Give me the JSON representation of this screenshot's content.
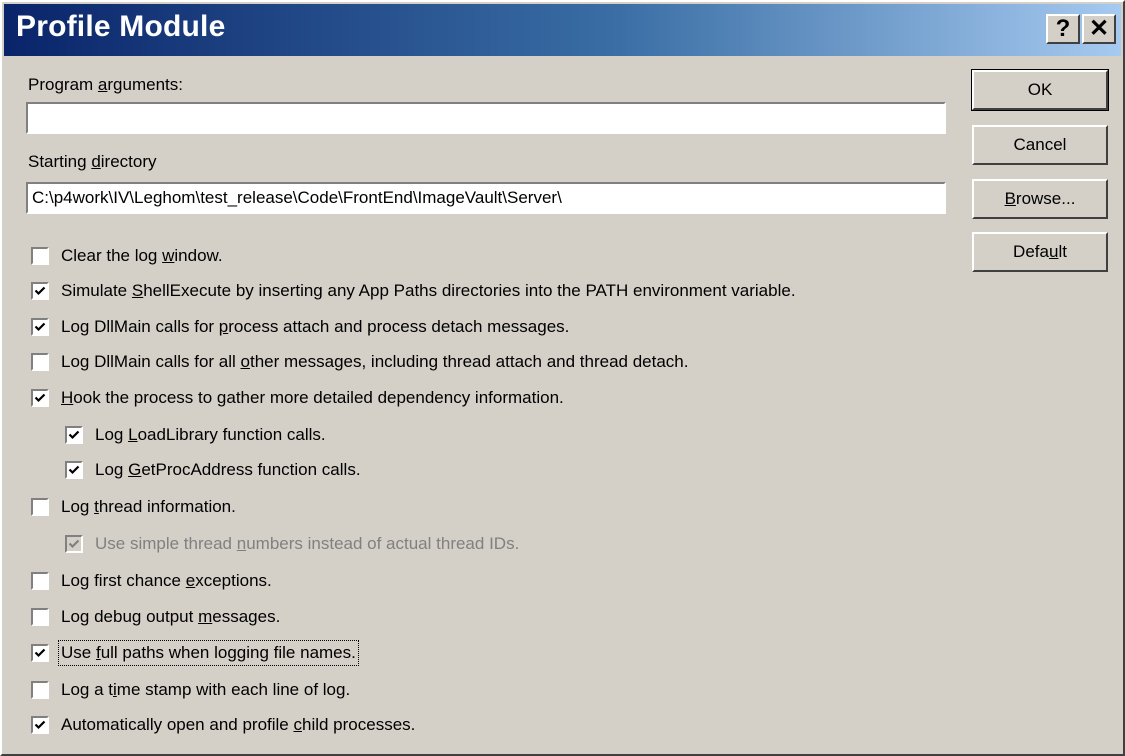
{
  "window": {
    "title": "Profile Module",
    "help_label": "?",
    "close_label": "✕"
  },
  "fields": {
    "program_arguments": {
      "label_pre": "Program ",
      "label_key": "a",
      "label_post": "rguments:",
      "value": ""
    },
    "starting_directory": {
      "label_pre": "Starting ",
      "label_key": "d",
      "label_post": "irectory",
      "value": "C:\\p4work\\IV\\Leghom\\test_release\\Code\\FrontEnd\\ImageVault\\Server\\"
    }
  },
  "buttons": {
    "ok": {
      "label": "OK"
    },
    "cancel": {
      "label": "Cancel"
    },
    "browse": {
      "pre": "",
      "key": "B",
      "post": "rowse..."
    },
    "default": {
      "pre": "Defa",
      "key": "u",
      "post": "lt"
    }
  },
  "options": [
    {
      "pre": "Clear the log ",
      "key": "w",
      "post": "indow.",
      "checked": false,
      "disabled": false
    },
    {
      "pre": "Simulate ",
      "key": "S",
      "post": "hellExecute by inserting any App Paths directories into the PATH environment variable.",
      "checked": true,
      "disabled": false
    },
    {
      "pre": "Log DllMain calls for ",
      "key": "p",
      "post": "rocess attach and process detach messages.",
      "checked": true,
      "disabled": false
    },
    {
      "pre": "Log DllMain calls for all ",
      "key": "o",
      "post": "ther messages, including thread attach and thread detach.",
      "checked": false,
      "disabled": false
    },
    {
      "pre": "",
      "key": "H",
      "post": "ook the process to gather more detailed dependency information.",
      "checked": true,
      "disabled": false
    },
    {
      "pre": "Log ",
      "key": "L",
      "post": "oadLibrary function calls.",
      "checked": true,
      "disabled": false
    },
    {
      "pre": "Log ",
      "key": "G",
      "post": "etProcAddress function calls.",
      "checked": true,
      "disabled": false
    },
    {
      "pre": "Log ",
      "key": "t",
      "post": "hread information.",
      "checked": false,
      "disabled": false
    },
    {
      "pre": "Use simple thread ",
      "key": "n",
      "post": "umbers instead of actual thread IDs.",
      "checked": true,
      "disabled": true
    },
    {
      "pre": "Log first chance ",
      "key": "e",
      "post": "xceptions.",
      "checked": false,
      "disabled": false
    },
    {
      "pre": "Log debug output ",
      "key": "m",
      "post": "essages.",
      "checked": false,
      "disabled": false
    },
    {
      "pre": "Use ",
      "key": "f",
      "post": "ull paths when logging file names.",
      "checked": true,
      "disabled": false
    },
    {
      "pre": "Log a t",
      "key": "i",
      "post": "me stamp with each line of log.",
      "checked": false,
      "disabled": false
    },
    {
      "pre": "Automatically open and profile ",
      "key": "c",
      "post": "hild processes.",
      "checked": true,
      "disabled": false
    }
  ]
}
